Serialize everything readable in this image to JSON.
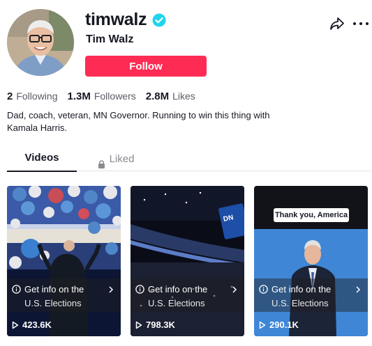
{
  "profile": {
    "username": "timwalz",
    "display_name": "Tim Walz",
    "verified": true,
    "follow_label": "Follow",
    "bio_line1": "Dad, coach, veteran, MN Governor. Running to win this thing with",
    "bio_line2": "Kamala Harris."
  },
  "stats": {
    "following_count": "2",
    "following_label": "Following",
    "followers_count": "1.3M",
    "followers_label": "Followers",
    "likes_count": "2.8M",
    "likes_label": "Likes"
  },
  "tabs": {
    "videos_label": "Videos",
    "liked_label": "Liked"
  },
  "videos": [
    {
      "banner_line1": "Get info on the",
      "banner_line2": "U.S. Elections",
      "views": "423.6K"
    },
    {
      "banner_line1": "Get info on the",
      "banner_line2": "U.S. Elections",
      "views": "798.3K"
    },
    {
      "banner_line1": "Get info on the",
      "banner_line2": "U.S. Elections",
      "views": "290.1K",
      "caption": "Thank you, America"
    }
  ],
  "colors": {
    "follow_button": "#fe2c55",
    "verified_badge": "#20d5ec",
    "text_primary": "#161823",
    "text_secondary": "#5a5c64"
  },
  "icons": [
    "verified-icon",
    "share-icon",
    "more-icon",
    "lock-icon",
    "info-icon",
    "chevron-right-icon",
    "play-icon"
  ]
}
